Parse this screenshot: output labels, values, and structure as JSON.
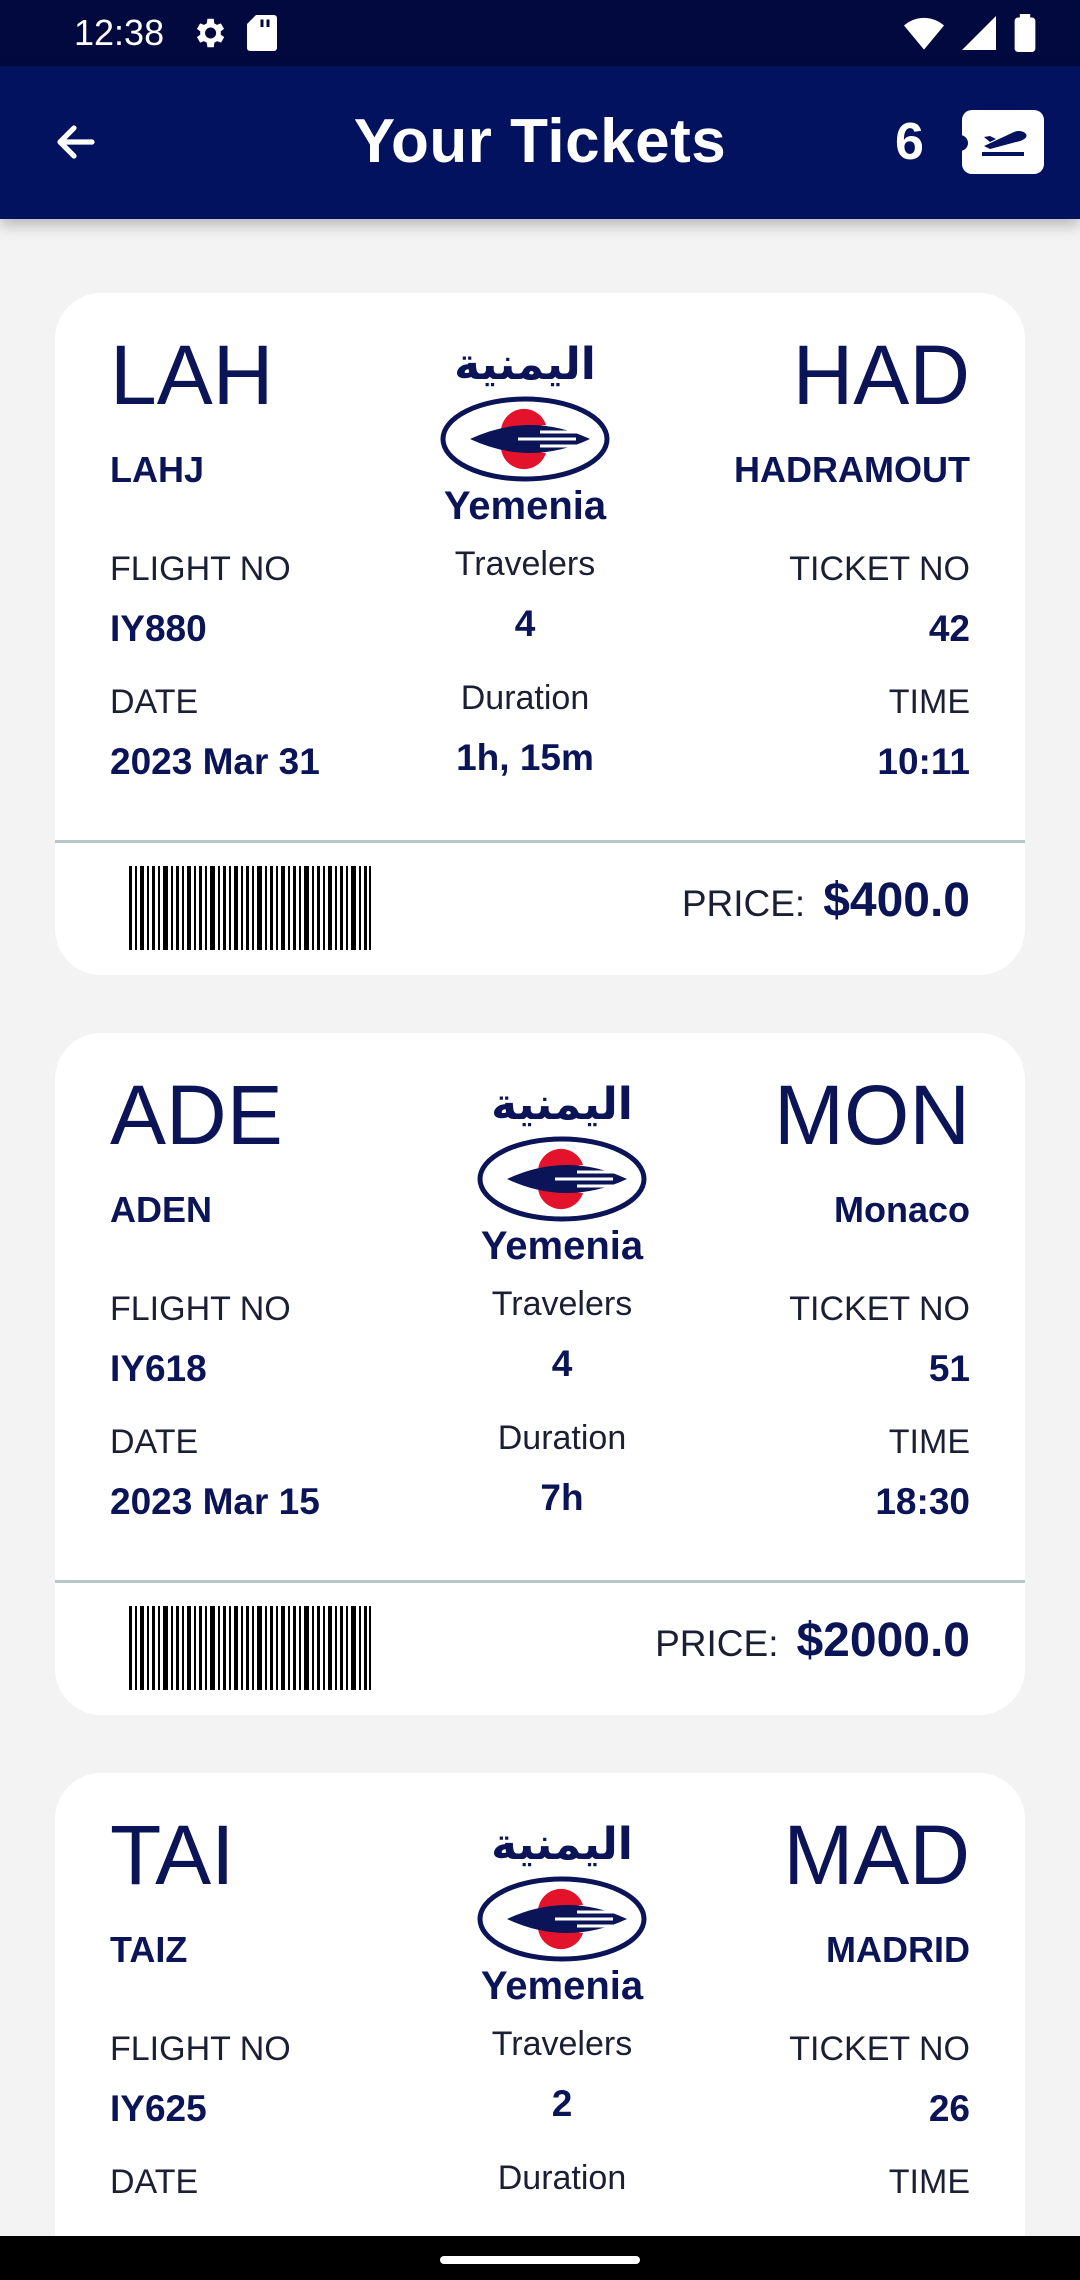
{
  "status": {
    "time": "12:38"
  },
  "appbar": {
    "title": "Your Tickets",
    "count": "6"
  },
  "labels": {
    "flight_no": "FLIGHT NO",
    "ticket_no": "TICKET NO",
    "travelers": "Travelers",
    "date": "DATE",
    "duration": "Duration",
    "time": "TIME",
    "price": "PRICE:"
  },
  "airline": {
    "name": "Yemenia",
    "arabic": "اليمنية"
  },
  "colors": {
    "primary": "#02125f",
    "status": "#02093f",
    "accent_red": "#e3132b"
  },
  "tickets": [
    {
      "from_code": "LAH",
      "from_city": "LAHJ",
      "to_code": "HAD",
      "to_city": "HADRAMOUT",
      "flight_no": "IY880",
      "travelers": "4",
      "ticket_no": "42",
      "date": "2023 Mar 31",
      "duration": "1h, 15m",
      "time": "10:11",
      "price": "$400.0"
    },
    {
      "from_code": "ADE",
      "from_city": "ADEN",
      "to_code": "MON",
      "to_city": "Monaco",
      "flight_no": "IY618",
      "travelers": "4",
      "ticket_no": "51",
      "date": "2023 Mar 15",
      "duration": "7h",
      "time": "18:30",
      "price": "$2000.0"
    },
    {
      "from_code": "TAI",
      "from_city": "TAIZ",
      "to_code": "MAD",
      "to_city": "MADRID",
      "flight_no": "IY625",
      "travelers": "2",
      "ticket_no": "26",
      "date": "",
      "duration": "",
      "time": "",
      "price": ""
    }
  ]
}
